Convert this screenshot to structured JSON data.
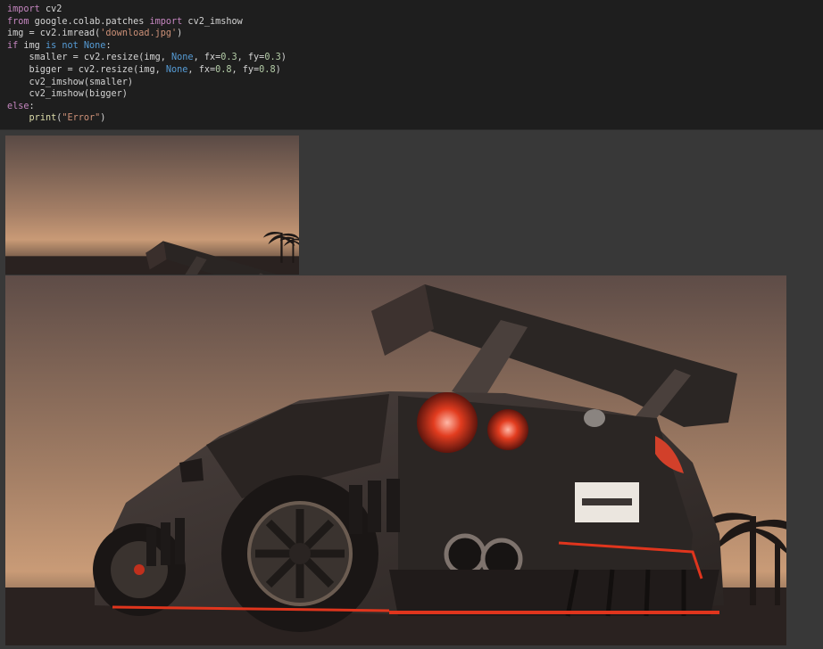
{
  "code": {
    "lines": [
      {
        "tokens": [
          {
            "t": "import",
            "c": "kw"
          },
          {
            "t": " cv2",
            "c": ""
          }
        ]
      },
      {
        "tokens": [
          {
            "t": "from",
            "c": "kw"
          },
          {
            "t": " google.colab.patches ",
            "c": ""
          },
          {
            "t": "import",
            "c": "kw"
          },
          {
            "t": " cv2_imshow",
            "c": ""
          }
        ]
      },
      {
        "tokens": [
          {
            "t": "img = cv2.imread(",
            "c": ""
          },
          {
            "t": "'download.jpg'",
            "c": "str"
          },
          {
            "t": ")",
            "c": ""
          }
        ]
      },
      {
        "tokens": [
          {
            "t": "if",
            "c": "kw"
          },
          {
            "t": " img ",
            "c": ""
          },
          {
            "t": "is not",
            "c": "kw2"
          },
          {
            "t": " ",
            "c": ""
          },
          {
            "t": "None",
            "c": "kw2"
          },
          {
            "t": ":",
            "c": ""
          }
        ]
      },
      {
        "tokens": [
          {
            "t": "    smaller = cv2.resize(img, ",
            "c": ""
          },
          {
            "t": "None",
            "c": "kw2"
          },
          {
            "t": ", fx=",
            "c": ""
          },
          {
            "t": "0.3",
            "c": "num"
          },
          {
            "t": ", fy=",
            "c": ""
          },
          {
            "t": "0.3",
            "c": "num"
          },
          {
            "t": ")",
            "c": ""
          }
        ]
      },
      {
        "tokens": [
          {
            "t": "    bigger = cv2.resize(img, ",
            "c": ""
          },
          {
            "t": "None",
            "c": "kw2"
          },
          {
            "t": ", fx=",
            "c": ""
          },
          {
            "t": "0.8",
            "c": "num"
          },
          {
            "t": ", fy=",
            "c": ""
          },
          {
            "t": "0.8",
            "c": "num"
          },
          {
            "t": ")",
            "c": ""
          }
        ]
      },
      {
        "tokens": [
          {
            "t": "    cv2_imshow(smaller)",
            "c": ""
          }
        ]
      },
      {
        "tokens": [
          {
            "t": "    cv2_imshow(bigger)",
            "c": ""
          }
        ]
      },
      {
        "tokens": [
          {
            "t": "else",
            "c": "kw"
          },
          {
            "t": ":",
            "c": ""
          }
        ]
      },
      {
        "tokens": [
          {
            "t": "    ",
            "c": ""
          },
          {
            "t": "print",
            "c": "fn"
          },
          {
            "t": "(",
            "c": ""
          },
          {
            "t": "\"Error\"",
            "c": "str"
          },
          {
            "t": ")",
            "c": ""
          }
        ]
      }
    ]
  },
  "outputs": {
    "small_image": {
      "subject": "car-photo",
      "scale": "0.3"
    },
    "big_image": {
      "subject": "car-photo",
      "scale": "0.8"
    }
  },
  "colors": {
    "editor_bg": "#1e1e1e",
    "output_bg": "#383838",
    "keyword": "#c586c0",
    "builtin": "#569cd6",
    "string": "#ce9178",
    "number": "#b5cea8"
  }
}
